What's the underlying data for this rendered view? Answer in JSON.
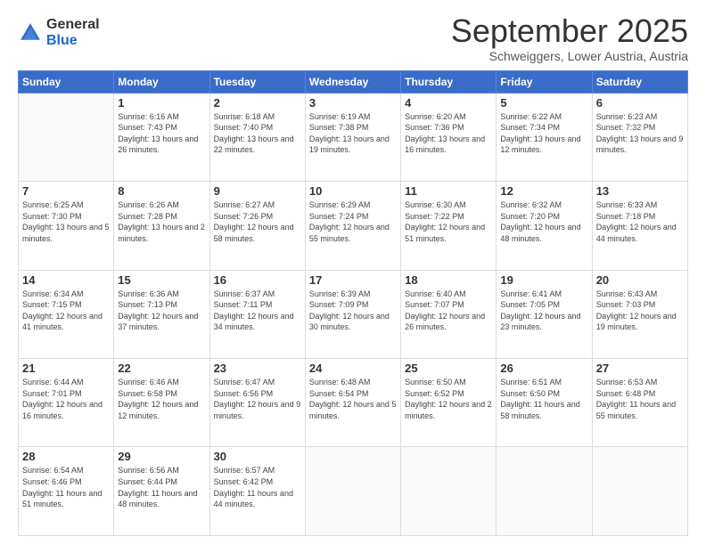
{
  "logo": {
    "general": "General",
    "blue": "Blue"
  },
  "title": "September 2025",
  "subtitle": "Schweiggers, Lower Austria, Austria",
  "weekdays": [
    "Sunday",
    "Monday",
    "Tuesday",
    "Wednesday",
    "Thursday",
    "Friday",
    "Saturday"
  ],
  "weeks": [
    [
      {
        "day": "",
        "info": ""
      },
      {
        "day": "1",
        "info": "Sunrise: 6:16 AM\nSunset: 7:43 PM\nDaylight: 13 hours\nand 26 minutes."
      },
      {
        "day": "2",
        "info": "Sunrise: 6:18 AM\nSunset: 7:40 PM\nDaylight: 13 hours\nand 22 minutes."
      },
      {
        "day": "3",
        "info": "Sunrise: 6:19 AM\nSunset: 7:38 PM\nDaylight: 13 hours\nand 19 minutes."
      },
      {
        "day": "4",
        "info": "Sunrise: 6:20 AM\nSunset: 7:36 PM\nDaylight: 13 hours\nand 16 minutes."
      },
      {
        "day": "5",
        "info": "Sunrise: 6:22 AM\nSunset: 7:34 PM\nDaylight: 13 hours\nand 12 minutes."
      },
      {
        "day": "6",
        "info": "Sunrise: 6:23 AM\nSunset: 7:32 PM\nDaylight: 13 hours\nand 9 minutes."
      }
    ],
    [
      {
        "day": "7",
        "info": "Sunrise: 6:25 AM\nSunset: 7:30 PM\nDaylight: 13 hours\nand 5 minutes."
      },
      {
        "day": "8",
        "info": "Sunrise: 6:26 AM\nSunset: 7:28 PM\nDaylight: 13 hours\nand 2 minutes."
      },
      {
        "day": "9",
        "info": "Sunrise: 6:27 AM\nSunset: 7:26 PM\nDaylight: 12 hours\nand 58 minutes."
      },
      {
        "day": "10",
        "info": "Sunrise: 6:29 AM\nSunset: 7:24 PM\nDaylight: 12 hours\nand 55 minutes."
      },
      {
        "day": "11",
        "info": "Sunrise: 6:30 AM\nSunset: 7:22 PM\nDaylight: 12 hours\nand 51 minutes."
      },
      {
        "day": "12",
        "info": "Sunrise: 6:32 AM\nSunset: 7:20 PM\nDaylight: 12 hours\nand 48 minutes."
      },
      {
        "day": "13",
        "info": "Sunrise: 6:33 AM\nSunset: 7:18 PM\nDaylight: 12 hours\nand 44 minutes."
      }
    ],
    [
      {
        "day": "14",
        "info": "Sunrise: 6:34 AM\nSunset: 7:15 PM\nDaylight: 12 hours\nand 41 minutes."
      },
      {
        "day": "15",
        "info": "Sunrise: 6:36 AM\nSunset: 7:13 PM\nDaylight: 12 hours\nand 37 minutes."
      },
      {
        "day": "16",
        "info": "Sunrise: 6:37 AM\nSunset: 7:11 PM\nDaylight: 12 hours\nand 34 minutes."
      },
      {
        "day": "17",
        "info": "Sunrise: 6:39 AM\nSunset: 7:09 PM\nDaylight: 12 hours\nand 30 minutes."
      },
      {
        "day": "18",
        "info": "Sunrise: 6:40 AM\nSunset: 7:07 PM\nDaylight: 12 hours\nand 26 minutes."
      },
      {
        "day": "19",
        "info": "Sunrise: 6:41 AM\nSunset: 7:05 PM\nDaylight: 12 hours\nand 23 minutes."
      },
      {
        "day": "20",
        "info": "Sunrise: 6:43 AM\nSunset: 7:03 PM\nDaylight: 12 hours\nand 19 minutes."
      }
    ],
    [
      {
        "day": "21",
        "info": "Sunrise: 6:44 AM\nSunset: 7:01 PM\nDaylight: 12 hours\nand 16 minutes."
      },
      {
        "day": "22",
        "info": "Sunrise: 6:46 AM\nSunset: 6:58 PM\nDaylight: 12 hours\nand 12 minutes."
      },
      {
        "day": "23",
        "info": "Sunrise: 6:47 AM\nSunset: 6:56 PM\nDaylight: 12 hours\nand 9 minutes."
      },
      {
        "day": "24",
        "info": "Sunrise: 6:48 AM\nSunset: 6:54 PM\nDaylight: 12 hours\nand 5 minutes."
      },
      {
        "day": "25",
        "info": "Sunrise: 6:50 AM\nSunset: 6:52 PM\nDaylight: 12 hours\nand 2 minutes."
      },
      {
        "day": "26",
        "info": "Sunrise: 6:51 AM\nSunset: 6:50 PM\nDaylight: 11 hours\nand 58 minutes."
      },
      {
        "day": "27",
        "info": "Sunrise: 6:53 AM\nSunset: 6:48 PM\nDaylight: 11 hours\nand 55 minutes."
      }
    ],
    [
      {
        "day": "28",
        "info": "Sunrise: 6:54 AM\nSunset: 6:46 PM\nDaylight: 11 hours\nand 51 minutes."
      },
      {
        "day": "29",
        "info": "Sunrise: 6:56 AM\nSunset: 6:44 PM\nDaylight: 11 hours\nand 48 minutes."
      },
      {
        "day": "30",
        "info": "Sunrise: 6:57 AM\nSunset: 6:42 PM\nDaylight: 11 hours\nand 44 minutes."
      },
      {
        "day": "",
        "info": ""
      },
      {
        "day": "",
        "info": ""
      },
      {
        "day": "",
        "info": ""
      },
      {
        "day": "",
        "info": ""
      }
    ]
  ]
}
